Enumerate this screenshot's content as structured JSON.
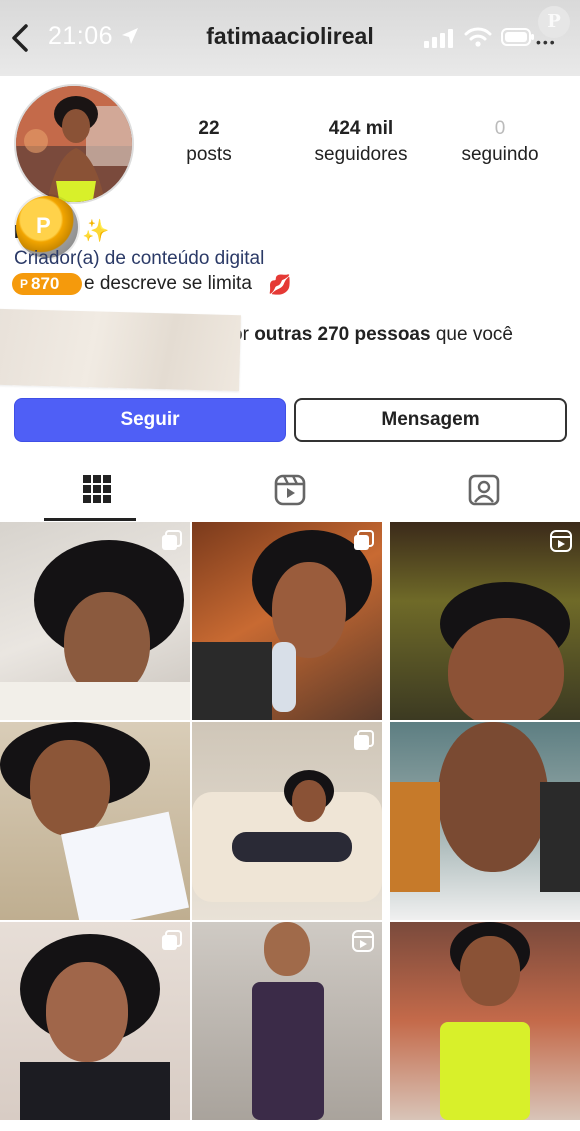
{
  "status": {
    "time": "21:06"
  },
  "header": {
    "username": "fatimaaciolireal"
  },
  "watermark": "P",
  "profile": {
    "name": "F",
    "sparkle": "✨",
    "category": "Criador(a) de conteúdo digital",
    "points": "870",
    "points_icon": "P",
    "bio": "e descreve se limita",
    "bio_emoji": "💋",
    "followed_prefix": "or ",
    "followed_bold": "outras 270 pessoas",
    "followed_suffix": " que você"
  },
  "stats": {
    "posts": {
      "value": "22",
      "label": "posts"
    },
    "followers": {
      "value": "424 mil",
      "label": "seguidores"
    },
    "following": {
      "value": "0",
      "label": "seguindo"
    }
  },
  "actions": {
    "follow": "Seguir",
    "message": "Mensagem"
  },
  "tabs": [
    {
      "icon": "grid-icon",
      "active": true
    },
    {
      "icon": "reels-icon",
      "active": false
    },
    {
      "icon": "tagged-icon",
      "active": false
    }
  ],
  "colors": {
    "primary_button": "#4f5ff6",
    "points_badge": "#f59a0c"
  },
  "posts": [
    {
      "kind": "multi"
    },
    {
      "kind": "multi"
    },
    {
      "kind": "reel"
    },
    {
      "kind": "none"
    },
    {
      "kind": "multi"
    },
    {
      "kind": "none"
    },
    {
      "kind": "multi"
    },
    {
      "kind": "reel"
    },
    {
      "kind": "none"
    }
  ]
}
